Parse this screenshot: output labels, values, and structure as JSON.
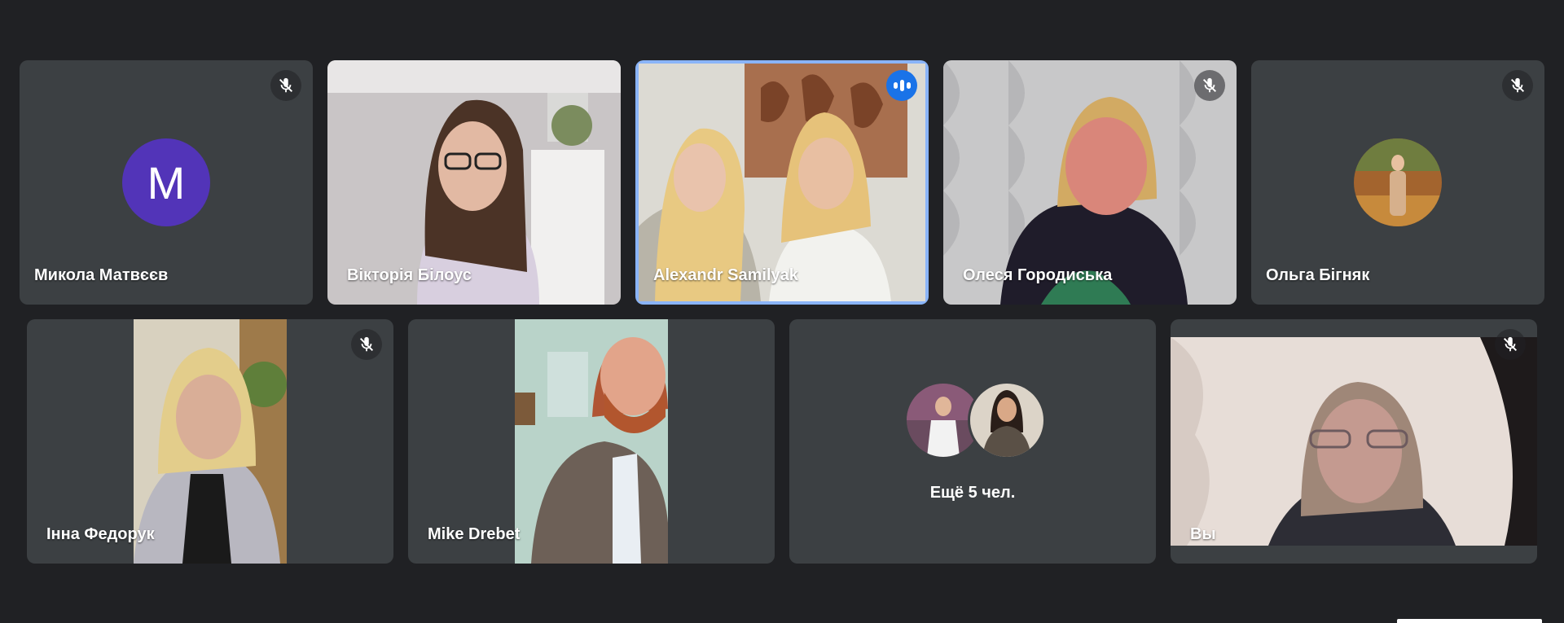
{
  "colors": {
    "background": "#202124",
    "tile": "#3c4043",
    "speaking_border": "#8ab4f8",
    "speaking_badge": "#1a73e8",
    "avatar_m": "#5234b8"
  },
  "participants_row1": [
    {
      "name": "Микола Матвєєв",
      "muted": true,
      "avatar_letter": "M"
    },
    {
      "name": "Вікторія Білоус",
      "muted": false
    },
    {
      "name": "Alexandr Samilyak",
      "speaking": true
    },
    {
      "name": "Олеся Городиська",
      "muted": true
    },
    {
      "name": "Ольга Бігняк",
      "muted": true
    }
  ],
  "participants_row2": [
    {
      "name": "Інна Федорук",
      "muted": true
    },
    {
      "name": "Mike Drebet",
      "muted": false
    },
    {
      "name": "Вы",
      "muted": true
    }
  ],
  "more": {
    "label": "Ещё 5 чел."
  },
  "icons": {
    "mute": "mic-off-icon",
    "speaking": "audio-level-icon"
  }
}
